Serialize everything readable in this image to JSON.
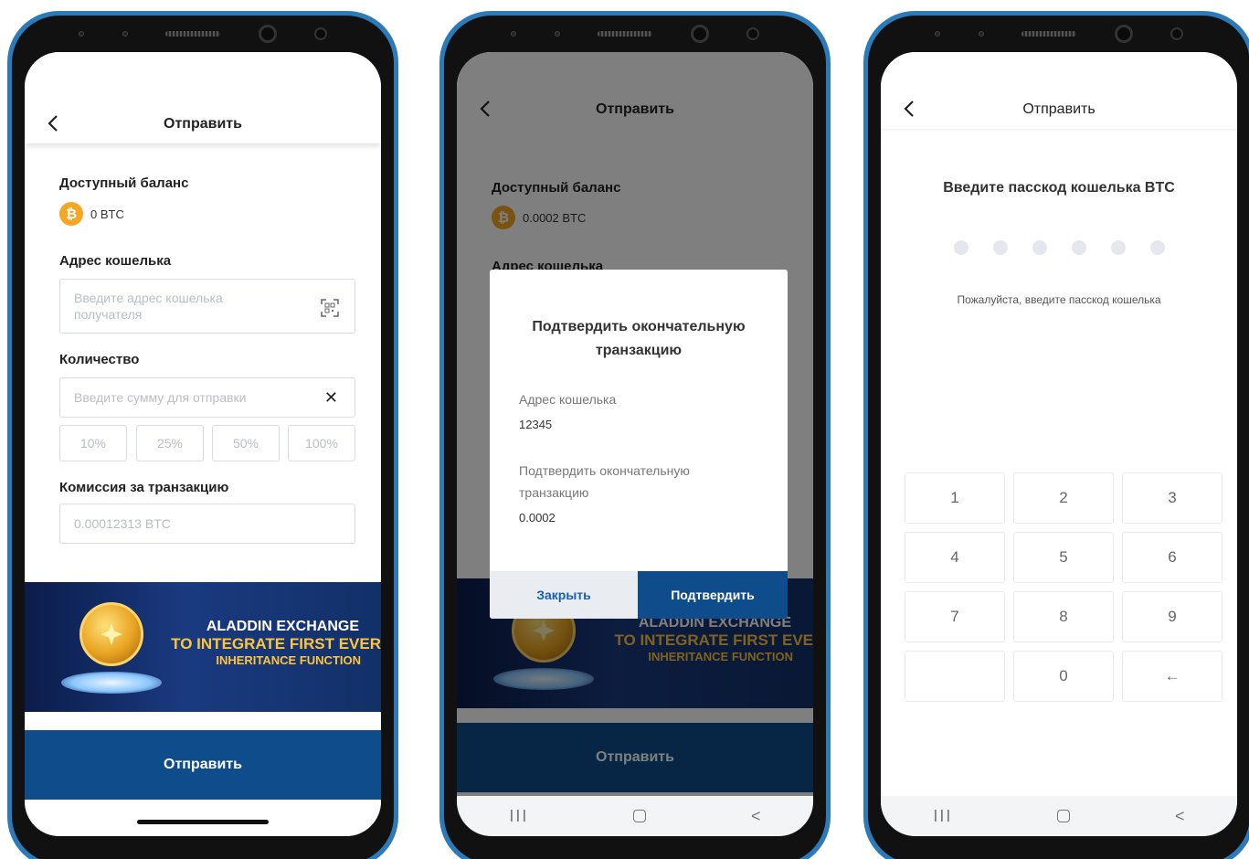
{
  "colors": {
    "accent": "#0f4c8c",
    "frame": "#2c7bb8",
    "btc": "#f5a623"
  },
  "screen1": {
    "title": "Отправить",
    "balance_label": "Доступный баланс",
    "balance_value": "0 BTC",
    "address_label": "Адрес кошелька",
    "address_placeholder": "Введите адрес кошелька получателя",
    "amount_label": "Количество",
    "amount_placeholder": "Введите сумму для отправки",
    "percent_buttons": [
      "10%",
      "25%",
      "50%",
      "100%"
    ],
    "fee_label": "Комиссия за транзакцию",
    "fee_value": "0.00012313 BTC",
    "banner": {
      "line1": "ALADDIN EXCHANGE",
      "line2": "TO INTEGRATE FIRST EVER",
      "line3": "INHERITANCE FUNCTION"
    },
    "send_button": "Отправить"
  },
  "screen2": {
    "title": "Отправить",
    "balance_label": "Доступный баланс",
    "balance_value": "0.0002 BTC",
    "address_label_partial": "Адрес кошелька",
    "modal": {
      "title": "Подтвердить окончательную транзакцию",
      "address_label": "Адрес кошелька",
      "address_value": "12345",
      "amount_label": "Подтвердить окончательную транзакцию",
      "amount_value": "0.0002",
      "close_button": "Закрыть",
      "confirm_button": "Подтвердить"
    },
    "banner": {
      "line1": "ALADDIN EXCHANGE",
      "line2": "TO INTEGRATE FIRST EVE",
      "line3": "INHERITANCE FUNCTION"
    },
    "send_button": "Отправить"
  },
  "screen3": {
    "title": "Отправить",
    "heading": "Введите пасскод кошелька BTC",
    "passcode_length": 6,
    "hint": "Пожалуйста, введите пасскод кошелька",
    "keys": [
      "1",
      "2",
      "3",
      "4",
      "5",
      "6",
      "7",
      "8",
      "9",
      "",
      "0",
      "←"
    ]
  },
  "nav": {
    "recent": "III",
    "back": "<"
  }
}
